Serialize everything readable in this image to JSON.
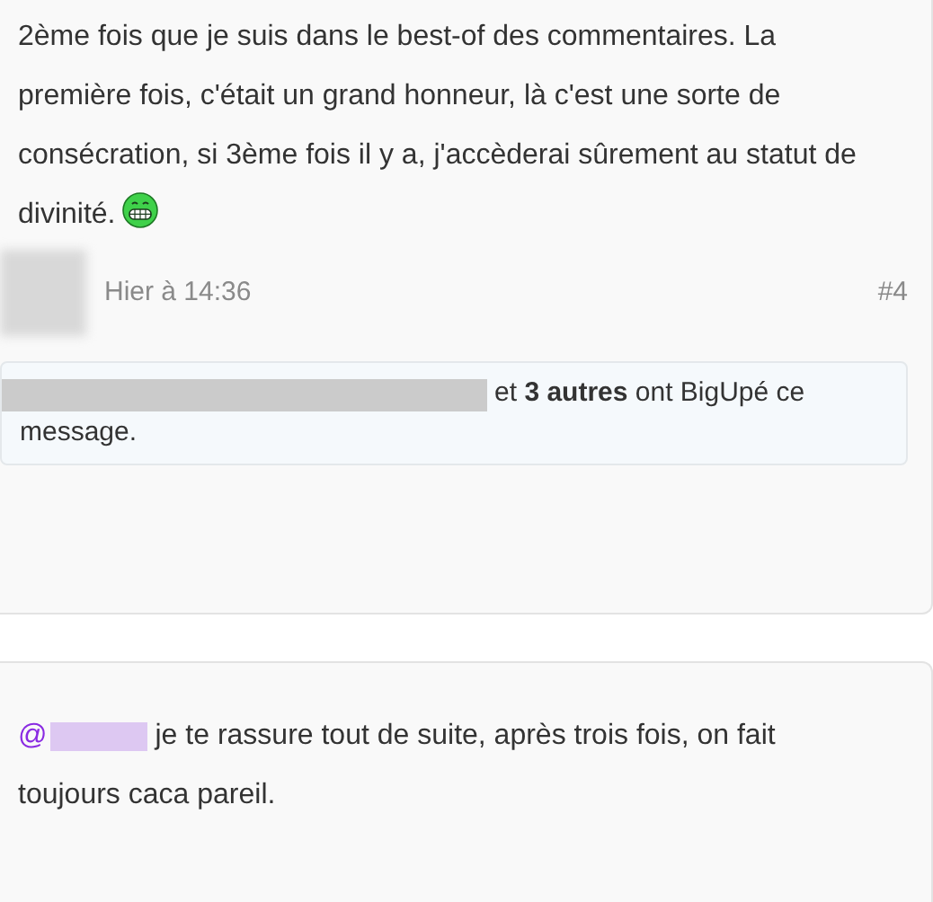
{
  "post": {
    "body": "2ème fois que je suis dans le best-of des commentaires. La première fois, c'était un grand honneur, là c'est une sorte de consécration, si 3ème fois il y a, j'accèderai sûrement au statut de divinité.",
    "time": "Hier à 14:36",
    "number": "#4",
    "likes": "et **3 autres** ont BigUpé ce message."
  },
  "reply": {
    "mention": "@",
    "body": "je te rassure tout de suite, après trois fois, on fait toujours caca pareil."
  }
}
